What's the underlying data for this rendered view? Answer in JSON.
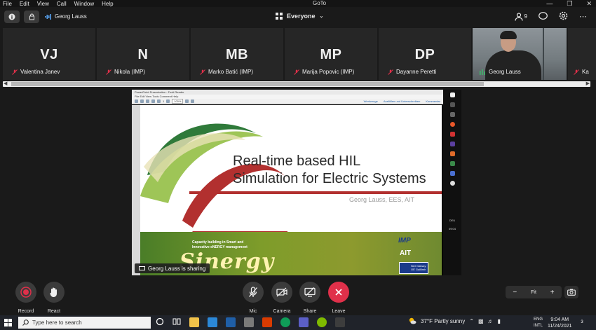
{
  "menubar": {
    "items": [
      "File",
      "Edit",
      "View",
      "Call",
      "Window",
      "Help"
    ],
    "app_title": "GoTo"
  },
  "topbar": {
    "speaker_name": "Georg Lauss",
    "audience": "Everyone",
    "participant_count": "9"
  },
  "participants": [
    {
      "initials": "VJ",
      "name": "Valentina Janev"
    },
    {
      "initials": "N",
      "name": "Nikola (IMP)"
    },
    {
      "initials": "MB",
      "name": "Marko Batić (IMP)"
    },
    {
      "initials": "MP",
      "name": "Marija Popovic (IMP)"
    },
    {
      "initials": "DP",
      "name": "Dayanne Peretti"
    },
    {
      "initials": "",
      "name": "Georg Lauss"
    },
    {
      "initials": "",
      "name": "Ka"
    }
  ],
  "shared_screen": {
    "window_title": "PowerPoint Presentation - Foxit Reader",
    "pdf_menu": "File  Edit  View  Tools  Comment  Help",
    "toolbar_links": [
      "Werkzeuge",
      "Ausfüllen und Unterschreiben",
      "Kommentar"
    ],
    "zoom": "100%",
    "page_num": "1",
    "slide_title_line1": "Real-time based HIL",
    "slide_title_line2": "Simulation for Electric Systems",
    "slide_subtitle": "Georg Lauss, EES, AIT",
    "footer_caption_line1": "Capacity building in Smart and",
    "footer_caption_line2": "Innovative eNERGY management",
    "footer_brand": "Sinergy",
    "logo_imp": "IMP",
    "logo_ait": "AIT",
    "logo_box_text": "NUI Galway OÉ Gaillimh",
    "rail_lang": "DEU",
    "rail_time": "09:04",
    "sharing_text": "Georg Lauss is sharing"
  },
  "controls": {
    "record": "Record",
    "react": "React",
    "mic": "Mic",
    "camera": "Camera",
    "share": "Share",
    "leave": "Leave",
    "zoom_fit": "Fit",
    "zoom_minus": "−",
    "zoom_plus": "+"
  },
  "taskbar": {
    "search_placeholder": "Type here to search",
    "weather": "37°F  Partly sunny",
    "lang_line1": "ENG",
    "lang_line2": "INTL",
    "time": "9:04 AM",
    "date": "11/24/2021",
    "notifications": "3"
  },
  "colors": {
    "leave_red": "#e0304a",
    "record_red": "#e0304a",
    "window_bg": "#1a1a1a",
    "tile_bg": "#262626"
  }
}
